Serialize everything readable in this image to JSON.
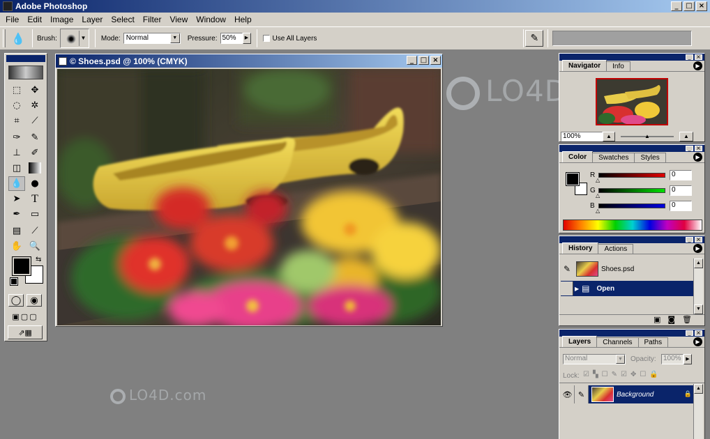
{
  "app": {
    "title": "Adobe Photoshop"
  },
  "menu": {
    "items": [
      "File",
      "Edit",
      "Image",
      "Layer",
      "Select",
      "Filter",
      "View",
      "Window",
      "Help"
    ]
  },
  "options": {
    "brush_label": "Brush:",
    "mode_label": "Mode:",
    "mode_value": "Normal",
    "pressure_label": "Pressure:",
    "pressure_value": "50%",
    "use_all_layers": "Use All Layers"
  },
  "document": {
    "title": "© Shoes.psd @ 100% (CMYK)"
  },
  "watermark": {
    "text_large": "LO4D",
    "text_small": "LO4D.com"
  },
  "navigator": {
    "tabs": [
      "Navigator",
      "Info"
    ],
    "zoom": "100%"
  },
  "color": {
    "tabs": [
      "Color",
      "Swatches",
      "Styles"
    ],
    "channels": [
      {
        "label": "R",
        "value": "0",
        "color": "#c00000"
      },
      {
        "label": "G",
        "value": "0",
        "color": "#00c000"
      },
      {
        "label": "B",
        "value": "0",
        "color": "#0000c0"
      }
    ],
    "foreground": "#000000",
    "background": "#ffffff"
  },
  "history": {
    "tabs": [
      "History",
      "Actions"
    ],
    "snapshot": "Shoes.psd",
    "states": [
      "Open"
    ]
  },
  "layers": {
    "tabs": [
      "Layers",
      "Channels",
      "Paths"
    ],
    "blend_mode": "Normal",
    "opacity_label": "Opacity:",
    "opacity_value": "100%",
    "lock_label": "Lock:",
    "layer_name": "Background"
  }
}
